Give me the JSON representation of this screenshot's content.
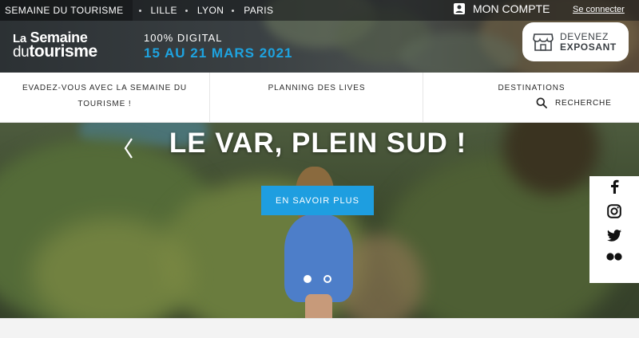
{
  "topbar": {
    "home": "SEMAINE DU TOURISME",
    "cities": [
      "LILLE",
      "LYON",
      "PARIS"
    ],
    "account": "MON COMPTE",
    "login": "Se connecter"
  },
  "logo": {
    "la": "La",
    "semaine": "Semaine",
    "du": "du",
    "tourisme": "tourisme"
  },
  "event": {
    "digital": "100% DIGITAL",
    "dates": "15 AU 21 MARS 2021"
  },
  "exposant": {
    "line1": "DEVENEZ",
    "line2": "EXPOSANT"
  },
  "nav": {
    "item1": "EVADEZ-VOUS AVEC LA SEMAINE DU TOURISME !",
    "item2": "PLANNING DES LIVES",
    "item3": "DESTINATIONS",
    "search": "RECHERCHE"
  },
  "hero": {
    "title": "LE VAR, PLEIN SUD !",
    "cta": "EN SAVOIR PLUS",
    "slides_total": 2,
    "slide_active": 1
  },
  "social": [
    "facebook-icon",
    "instagram-icon",
    "twitter-icon",
    "flickr-icon"
  ],
  "colors": {
    "accent": "#1e9ee0",
    "dark": "#2c3134"
  }
}
